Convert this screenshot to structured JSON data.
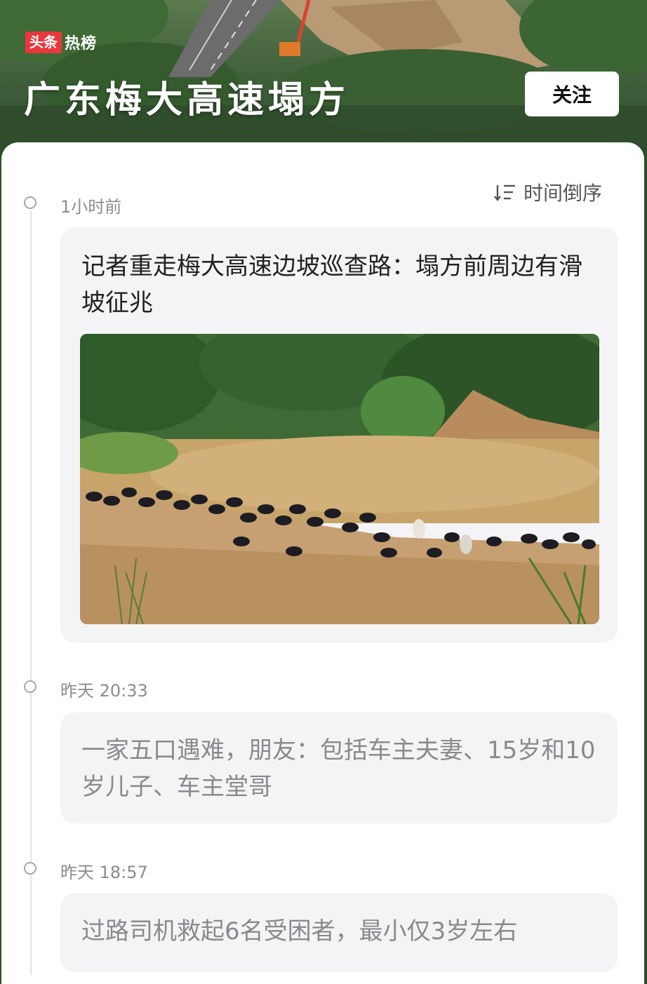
{
  "header": {
    "brand_box": "头条",
    "brand_text": "热榜",
    "title": "广东梅大高速塌方",
    "follow_label": "关注"
  },
  "sort": {
    "label": "时间倒序",
    "icon": "sort-descending-icon"
  },
  "timeline": [
    {
      "time": "1小时前",
      "title": "记者重走梅大高速边坡巡查路：塌方前周边有滑坡征兆",
      "has_image": true
    },
    {
      "time": "昨天 20:33",
      "title": "一家五口遇难，朋友：包括车主夫妻、15岁和10岁儿子、车主堂哥",
      "has_image": false
    },
    {
      "time": "昨天 18:57",
      "title": "过路司机救起6名受困者，最小仅3岁左右",
      "has_image": false
    }
  ],
  "colors": {
    "brand_red": "#e8383d",
    "banner_green": "#3c5a38",
    "card_bg": "#f4f4f6"
  }
}
